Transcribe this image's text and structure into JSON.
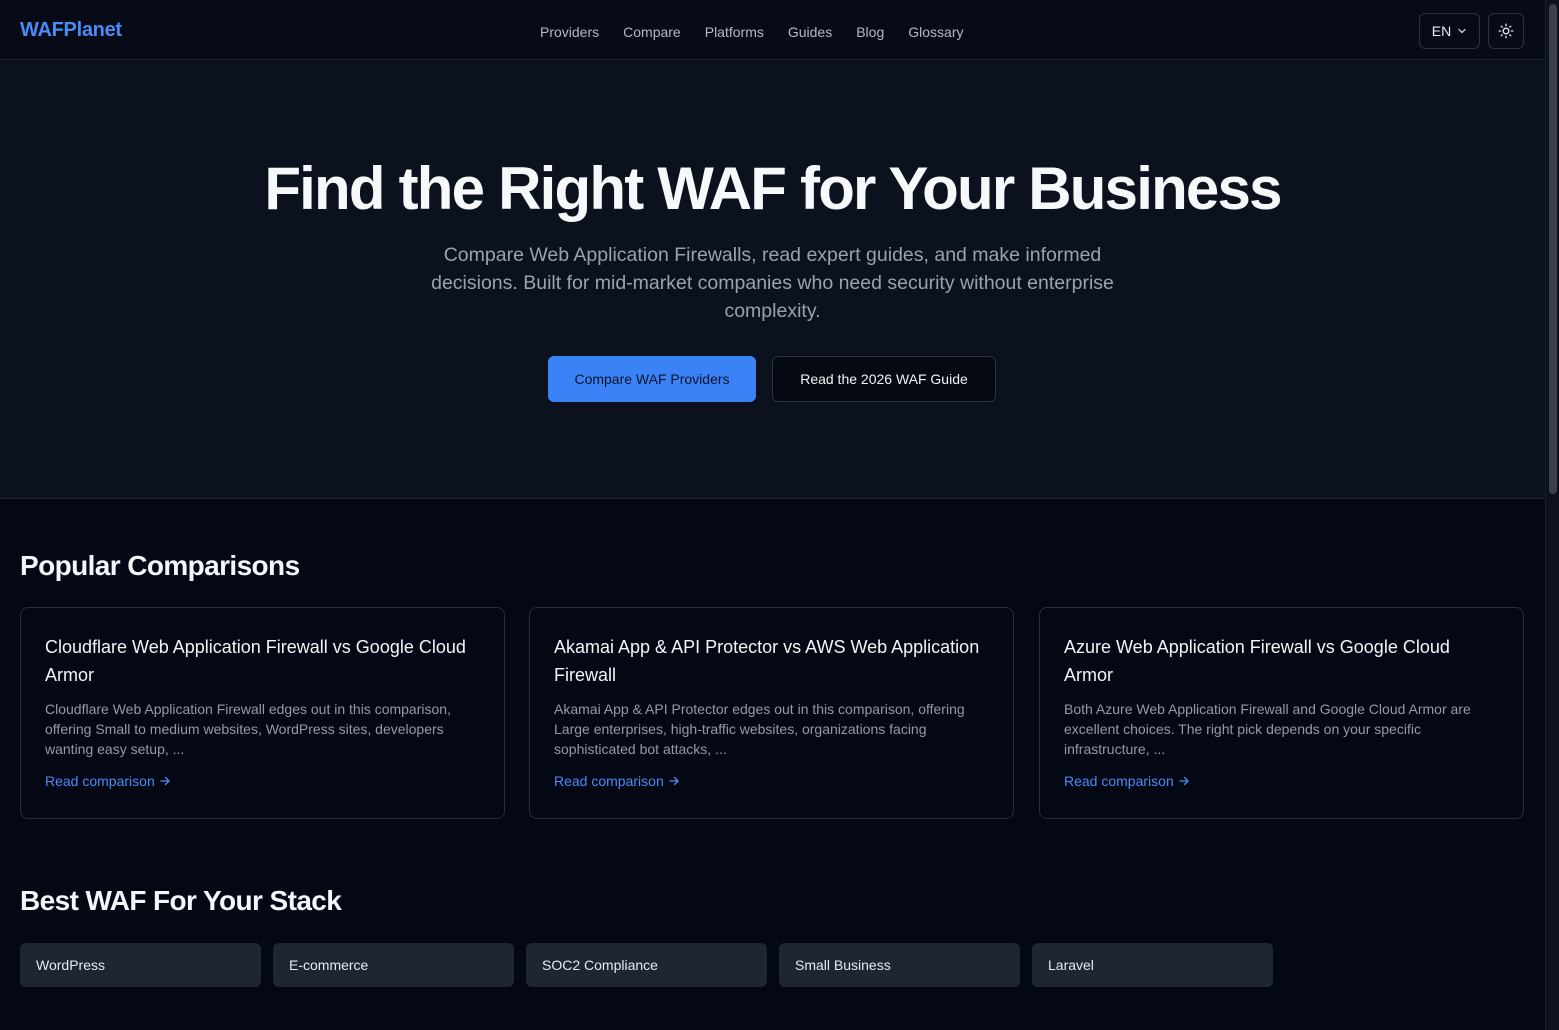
{
  "header": {
    "logo": "WAFPlanet",
    "nav": [
      "Providers",
      "Compare",
      "Platforms",
      "Guides",
      "Blog",
      "Glossary"
    ],
    "language": "EN"
  },
  "hero": {
    "title": "Find the Right WAF for Your Business",
    "subtitle": "Compare Web Application Firewalls, read expert guides, and make informed decisions. Built for mid-market companies who need security without enterprise complexity.",
    "primary_button": "Compare WAF Providers",
    "secondary_button": "Read the 2026 WAF Guide"
  },
  "popular": {
    "title": "Popular Comparisons",
    "cards": [
      {
        "title": "Cloudflare Web Application Firewall vs Google Cloud Armor",
        "desc": "Cloudflare Web Application Firewall edges out in this comparison, offering Small to medium websites, WordPress sites, developers wanting easy setup, ...",
        "link": "Read comparison"
      },
      {
        "title": "Akamai App & API Protector vs AWS Web Application Firewall",
        "desc": "Akamai App & API Protector edges out in this comparison, offering Large enterprises, high-traffic websites, organizations facing sophisticated bot attacks, ...",
        "link": "Read comparison"
      },
      {
        "title": "Azure Web Application Firewall vs Google Cloud Armor",
        "desc": "Both Azure Web Application Firewall and Google Cloud Armor are excellent choices. The right pick depends on your specific infrastructure, ...",
        "link": "Read comparison"
      }
    ]
  },
  "stack": {
    "title": "Best WAF For Your Stack",
    "items": [
      "WordPress",
      "E-commerce",
      "SOC2 Compliance",
      "Small Business",
      "Laravel"
    ]
  },
  "colors": {
    "accent": "#3b82f6",
    "background": "#040814",
    "hero_background": "#0b111d"
  }
}
